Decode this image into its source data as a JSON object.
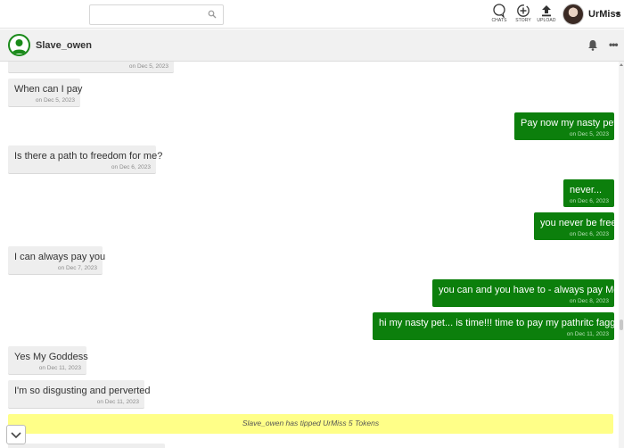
{
  "topbar": {
    "search": {
      "placeholder": "",
      "value": ""
    },
    "nav": [
      {
        "label": "CHATS",
        "icon": "chat-bubble-icon"
      },
      {
        "label": "STORY",
        "icon": "story-plus-icon"
      },
      {
        "label": "UPLOAD",
        "icon": "upload-arrow-icon"
      }
    ],
    "user": {
      "name": "UrMiss"
    }
  },
  "chat": {
    "partner": "Slave_owen",
    "partial_top_time": "on Dec 5, 2023",
    "messages": [
      {
        "dir": "in",
        "text": "When can I pay",
        "time": "on Dec 5, 2023"
      },
      {
        "dir": "out",
        "text": "Pay now my nasty pet",
        "time": "on Dec 5, 2023"
      },
      {
        "dir": "in",
        "text": "Is there a path to freedom for me?",
        "time": "on Dec 6, 2023"
      },
      {
        "dir": "out",
        "text": "never...",
        "time": "on Dec 6, 2023"
      },
      {
        "dir": "out",
        "text": "you never be free",
        "time": "on Dec 6, 2023"
      },
      {
        "dir": "in",
        "text": "I can always pay you",
        "time": "on Dec 7, 2023"
      },
      {
        "dir": "out",
        "text": "you can and you have to - always pay Me...",
        "time": "on Dec 8, 2023"
      },
      {
        "dir": "out",
        "text": "hi my nasty pet... is time!!! time to pay my pathritc faggot!",
        "time": "on Dec 11, 2023"
      },
      {
        "dir": "in",
        "text": "Yes My Goddess",
        "time": "on Dec 11, 2023"
      },
      {
        "dir": "in",
        "text": "I'm so disgusting and perverted",
        "time": "on Dec 11, 2023"
      }
    ],
    "tip_notice": "Slave_owen has tipped UrMiss 5 Tokens"
  },
  "colors": {
    "outgoing_bubble": "#0c7f0c",
    "incoming_bubble": "#eeeeee",
    "tip_banner": "#ffff88",
    "avatar_ring": "#1a8a1a"
  }
}
